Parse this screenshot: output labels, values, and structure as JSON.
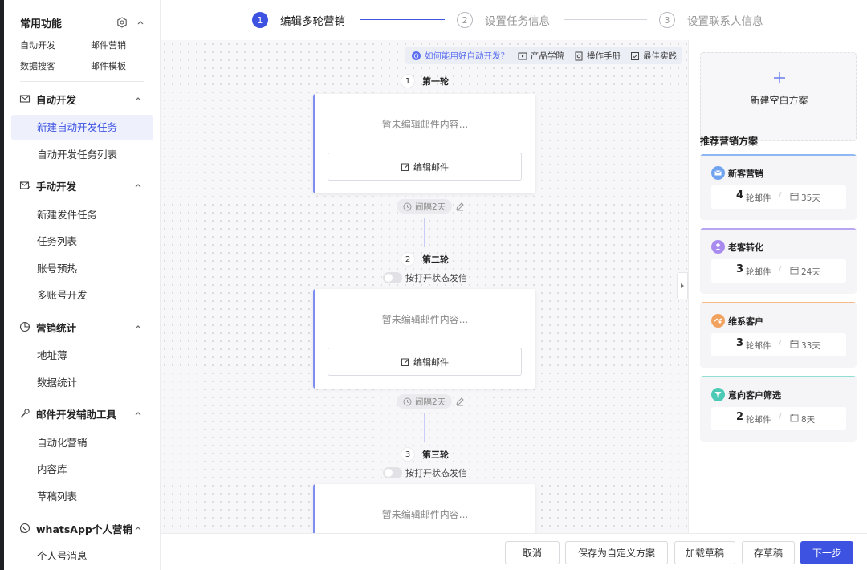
{
  "sidebar": {
    "quick_title": "常用功能",
    "quick_links": [
      "自动开发",
      "邮件营销",
      "数据搜客",
      "邮件模板"
    ],
    "groups": [
      {
        "label": "自动开发",
        "icon": "mail-icon",
        "items": [
          "新建自动开发任务",
          "自动开发任务列表"
        ]
      },
      {
        "label": "手动开发",
        "icon": "mail-send-icon",
        "items": [
          "新建发件任务",
          "任务列表",
          "账号预热",
          "多账号开发"
        ]
      },
      {
        "label": "营销统计",
        "icon": "pie-chart-icon",
        "items": [
          "地址薄",
          "数据统计"
        ]
      },
      {
        "label": "邮件开发辅助工具",
        "icon": "wrench-icon",
        "items": [
          "自动化营销",
          "内容库",
          "草稿列表"
        ]
      },
      {
        "label": "whatsApp个人营销",
        "icon": "whatsapp-icon",
        "items": [
          "个人号消息"
        ]
      }
    ],
    "active_item": "新建自动开发任务"
  },
  "steps": [
    {
      "num": "1",
      "label": "编辑多轮营销",
      "active": true
    },
    {
      "num": "2",
      "label": "设置任务信息",
      "active": false
    },
    {
      "num": "3",
      "label": "设置联系人信息",
      "active": false
    }
  ],
  "helpbar": {
    "question": "如何能用好自动开发？",
    "links": [
      "产品学院",
      "操作手册",
      "最佳实践"
    ]
  },
  "rounds": [
    {
      "num": "1",
      "label": "第一轮",
      "toggle_label": null,
      "empty_text": "暂未编辑邮件内容...",
      "edit_label": "编辑邮件",
      "interval": "间隔2天"
    },
    {
      "num": "2",
      "label": "第二轮",
      "toggle_label": "按打开状态发信",
      "empty_text": "暂未编辑邮件内容...",
      "edit_label": "编辑邮件",
      "interval": "间隔2天"
    },
    {
      "num": "3",
      "label": "第三轮",
      "toggle_label": "按打开状态发信",
      "empty_text": "暂未编辑邮件内容...",
      "edit_label": null,
      "interval": null
    }
  ],
  "right_panel": {
    "new_blank_label": "新建空白方案",
    "rec_title": "推荐营销方案",
    "plans": [
      {
        "name": "新客营销",
        "count": "4",
        "unit": "轮邮件",
        "days": "35天",
        "color": "#8fb8f2",
        "icon_color": "#6fa3ef",
        "icon": "mail-badge-icon"
      },
      {
        "name": "老客转化",
        "count": "3",
        "unit": "轮邮件",
        "days": "24天",
        "color": "#b9a6f2",
        "icon_color": "#a98bf0",
        "icon": "user-badge-icon"
      },
      {
        "name": "维系客户",
        "count": "3",
        "unit": "轮邮件",
        "days": "33天",
        "color": "#f5b98a",
        "icon_color": "#f2a25f",
        "icon": "handshake-badge-icon"
      },
      {
        "name": "意向客户筛选",
        "count": "2",
        "unit": "轮邮件",
        "days": "8天",
        "color": "#8fe0d3",
        "icon_color": "#4ccab5",
        "icon": "filter-badge-icon"
      }
    ]
  },
  "footer": {
    "cancel": "取消",
    "save_custom": "保存为自定义方案",
    "load_draft": "加载草稿",
    "save_draft": "存草稿",
    "next": "下一步"
  },
  "colors": {
    "accent": "#3d52e0",
    "active_bg": "#eef0fc",
    "card_accent": "#7d8ef0"
  }
}
